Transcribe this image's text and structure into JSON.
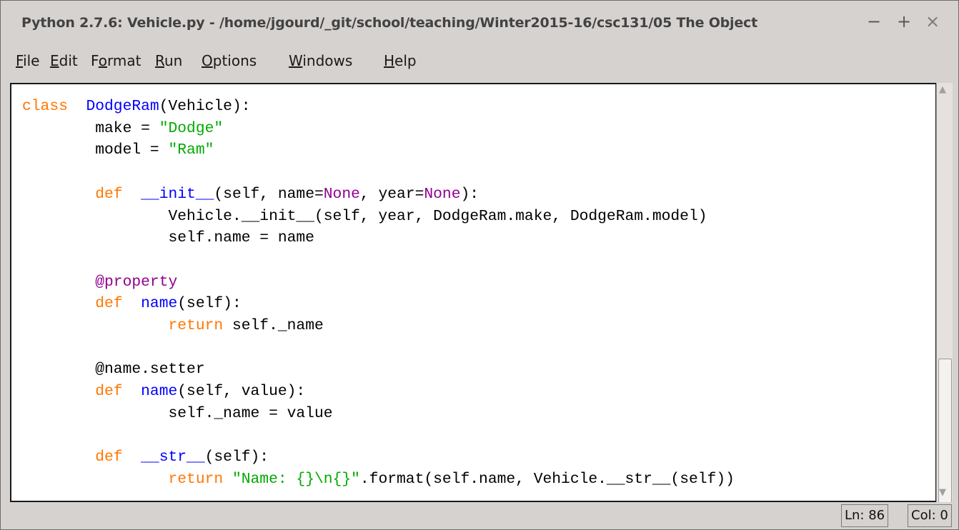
{
  "window": {
    "title": "Python 2.7.6: Vehicle.py - /home/jgourd/_git/school/teaching/Winter2015-16/csc131/05 The Object",
    "controls": {
      "minimize": "−",
      "maximize": "+",
      "close": "×"
    }
  },
  "menu": [
    {
      "accel": "F",
      "rest": "ile"
    },
    {
      "accel": "E",
      "rest": "dit"
    },
    {
      "pre": "F",
      "accel": "o",
      "rest": "rmat"
    },
    {
      "accel": "R",
      "rest": "un"
    },
    {
      "accel": "O",
      "rest": "ptions"
    },
    {
      "accel": "W",
      "rest": "indows"
    },
    {
      "accel": "H",
      "rest": "elp"
    }
  ],
  "editor": {
    "language": "python",
    "colors": {
      "keyword": "#ff7700",
      "definition": "#0000ff",
      "string": "#00aa00",
      "builtin": "#900090"
    },
    "lines": [
      [
        [
          "kw",
          "class"
        ],
        [
          "",
          "  "
        ],
        [
          "def",
          "DodgeRam"
        ],
        [
          "",
          "(Vehicle):"
        ]
      ],
      [
        [
          "",
          "        make = "
        ],
        [
          "str",
          "\"Dodge\""
        ]
      ],
      [
        [
          "",
          "        model = "
        ],
        [
          "str",
          "\"Ram\""
        ]
      ],
      [],
      [
        [
          "",
          "        "
        ],
        [
          "kw",
          "def"
        ],
        [
          "",
          "  "
        ],
        [
          "def",
          "__init__"
        ],
        [
          "",
          "(self, name="
        ],
        [
          "bi",
          "None"
        ],
        [
          "",
          ", year="
        ],
        [
          "bi",
          "None"
        ],
        [
          "",
          "):"
        ]
      ],
      [
        [
          "",
          "                Vehicle.__init__(self, year, DodgeRam.make, DodgeRam.model)"
        ]
      ],
      [
        [
          "",
          "                self.name = name"
        ]
      ],
      [],
      [
        [
          "",
          "        "
        ],
        [
          "bi",
          "@property"
        ]
      ],
      [
        [
          "",
          "        "
        ],
        [
          "kw",
          "def"
        ],
        [
          "",
          "  "
        ],
        [
          "def",
          "name"
        ],
        [
          "",
          "(self):"
        ]
      ],
      [
        [
          "",
          "                "
        ],
        [
          "kw",
          "return"
        ],
        [
          "",
          " self._name"
        ]
      ],
      [],
      [
        [
          "",
          "        @name.setter"
        ]
      ],
      [
        [
          "",
          "        "
        ],
        [
          "kw",
          "def"
        ],
        [
          "",
          "  "
        ],
        [
          "def",
          "name"
        ],
        [
          "",
          "(self, value):"
        ]
      ],
      [
        [
          "",
          "                self._name = value"
        ]
      ],
      [],
      [
        [
          "",
          "        "
        ],
        [
          "kw",
          "def"
        ],
        [
          "",
          "  "
        ],
        [
          "def",
          "__str__"
        ],
        [
          "",
          "(self):"
        ]
      ],
      [
        [
          "",
          "                "
        ],
        [
          "kw",
          "return"
        ],
        [
          "",
          " "
        ],
        [
          "str",
          "\"Name: {}\\n{}\""
        ],
        [
          "",
          ".format(self.name, Vehicle.__str__(self))"
        ]
      ]
    ]
  },
  "status": {
    "line": "Ln: 86",
    "column": "Col: 0"
  },
  "icons": {
    "scroll_up": "scroll-up-arrow-icon",
    "scroll_down": "scroll-down-arrow-icon"
  }
}
